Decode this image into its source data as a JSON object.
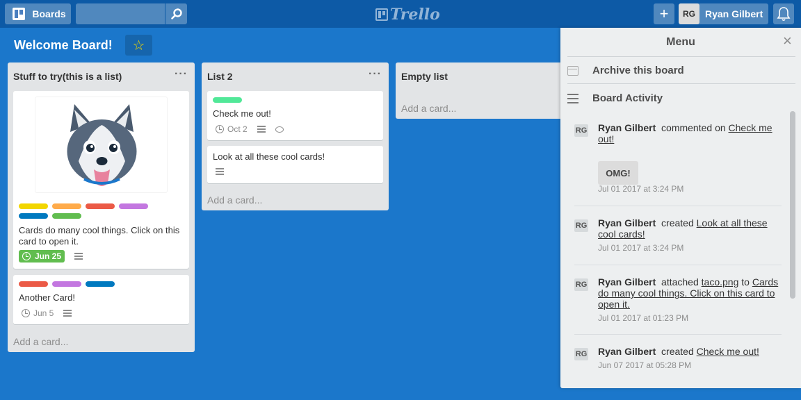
{
  "topbar": {
    "boards_label": "Boards",
    "search_value": "",
    "logo_text": "Trello",
    "add_label": "+",
    "user_initials": "RG",
    "user_name": "Ryan Gilbert"
  },
  "board": {
    "title": "Welcome Board!",
    "star": "☆"
  },
  "lists": [
    {
      "title": "Stuff to try(this is a list)",
      "menu": "···",
      "add_card": "Add a card...",
      "cards": [
        {
          "image": "husky-dog-illustration",
          "labels": [
            "#f2d600",
            "#ffab4a",
            "#eb5a46",
            "#c377e0",
            "#0079bf",
            "#61bd4f"
          ],
          "text": "Cards do many cool things. Click on this card to open it.",
          "due": "Jun 25",
          "due_color": "#61bd4f"
        },
        {
          "labels": [
            "#eb5a46",
            "#c377e0",
            "#0079bf"
          ],
          "text": "Another Card!",
          "date": "Jun 5"
        }
      ]
    },
    {
      "title": "List 2",
      "menu": "···",
      "add_card": "Add a card...",
      "cards": [
        {
          "labels": [
            "#51e898"
          ],
          "text": "Check me out!",
          "date": "Oct 2"
        },
        {
          "text": "Look at all these cool cards!"
        }
      ]
    },
    {
      "title": "Empty list",
      "add_card": "Add a card..."
    }
  ],
  "menu": {
    "title": "Menu",
    "close": "×",
    "archive_label": "Archive this board",
    "activity_label": "Board Activity",
    "activities": [
      {
        "initials": "RG",
        "user": "Ryan Gilbert",
        "action": "commented on",
        "target": "Check me out!",
        "comment": "OMG!",
        "time": "Jul 01 2017 at 3:24 PM"
      },
      {
        "initials": "RG",
        "user": "Ryan Gilbert",
        "action": "created",
        "target": "Look at all these cool cards!",
        "time": "Jul 01 2017 at 3:24 PM"
      },
      {
        "initials": "RG",
        "user": "Ryan Gilbert",
        "action": "attached",
        "attachment": "taco.png",
        "to": "to",
        "target": "Cards do many cool things. Click on this card to open it.",
        "time": "Jul 01 2017 at 01:23 PM"
      },
      {
        "initials": "RG",
        "user": "Ryan Gilbert",
        "action": "created",
        "target": "Check me out!",
        "time": "Jun 07 2017 at 05:28 PM"
      }
    ]
  }
}
